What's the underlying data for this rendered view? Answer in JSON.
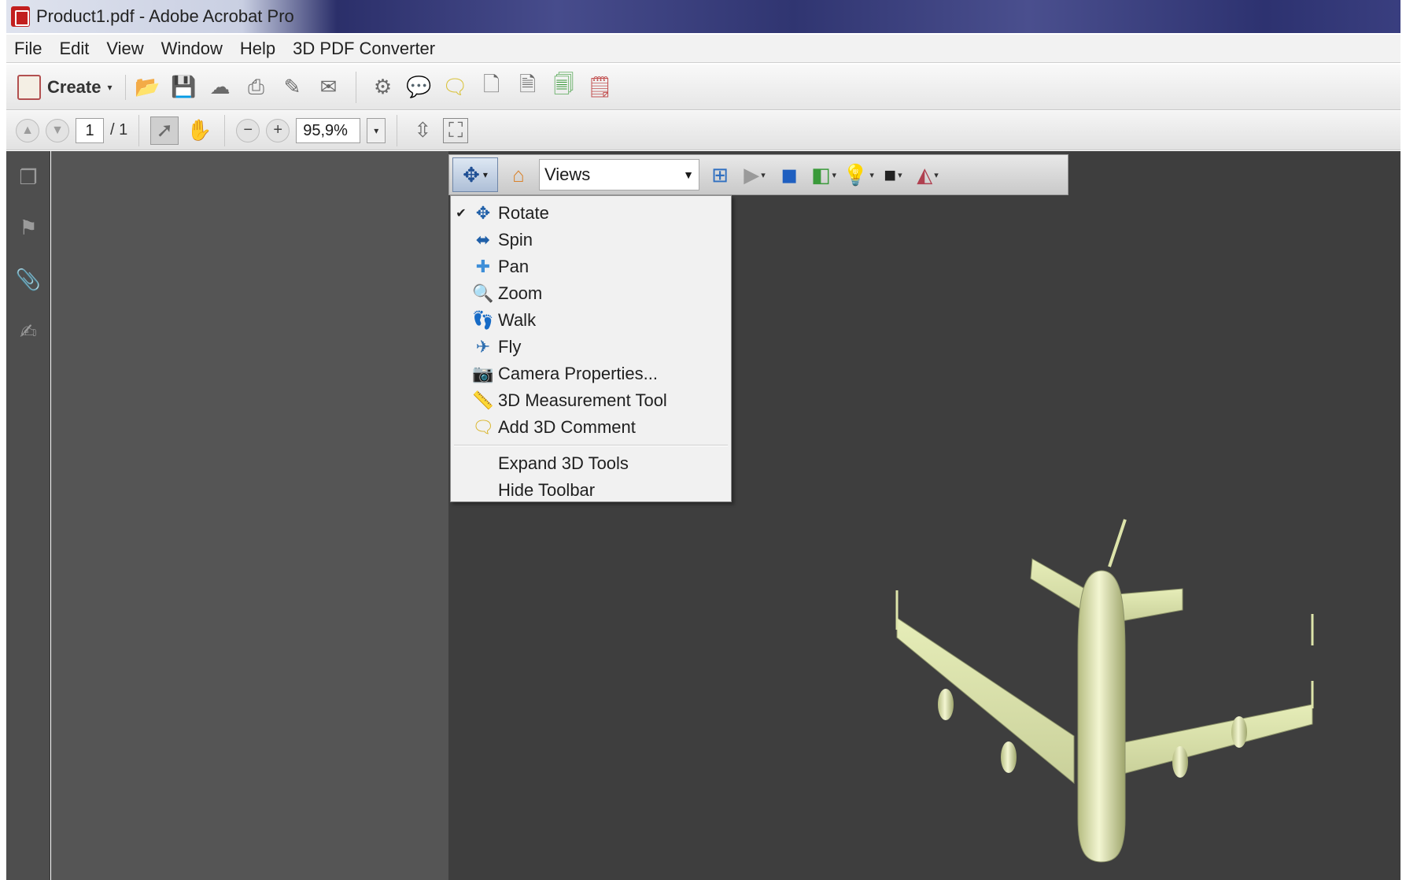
{
  "window": {
    "title": "Product1.pdf - Adobe Acrobat Pro"
  },
  "menubar": {
    "items": [
      "File",
      "Edit",
      "View",
      "Window",
      "Help",
      "3D PDF Converter"
    ]
  },
  "toolbar": {
    "create_label": "Create",
    "icons": [
      "open-folder-icon",
      "save-icon",
      "cloud-upload-icon",
      "print-icon",
      "edit-document-icon",
      "email-icon",
      "gear-icon",
      "comment-icon",
      "sticky-note-icon",
      "page-icon",
      "page-export-icon",
      "page-import-icon",
      "page-settings-icon"
    ]
  },
  "navbar": {
    "page_current": "1",
    "page_total": "/ 1",
    "zoom": "95,9%"
  },
  "toolbar3d": {
    "views_label": "Views"
  },
  "dropdown": {
    "items": [
      {
        "label": "Rotate",
        "checked": true,
        "icon": "rotate-icon"
      },
      {
        "label": "Spin",
        "checked": false,
        "icon": "spin-icon"
      },
      {
        "label": "Pan",
        "checked": false,
        "icon": "pan-icon"
      },
      {
        "label": "Zoom",
        "checked": false,
        "icon": "zoom-icon"
      },
      {
        "label": "Walk",
        "checked": false,
        "icon": "walk-icon"
      },
      {
        "label": "Fly",
        "checked": false,
        "icon": "fly-icon"
      },
      {
        "label": "Camera Properties...",
        "checked": false,
        "icon": "camera-icon"
      },
      {
        "label": "3D Measurement Tool",
        "checked": false,
        "icon": "ruler-icon"
      },
      {
        "label": "Add 3D Comment",
        "checked": false,
        "icon": "comment-3d-icon"
      }
    ],
    "extra_items": [
      {
        "label": "Expand 3D Tools"
      },
      {
        "label": "Hide Toolbar"
      }
    ]
  },
  "colors": {
    "doc_left": "#555555",
    "doc_3d": "#3e3e3e",
    "airplane": "#dfe7b0"
  }
}
